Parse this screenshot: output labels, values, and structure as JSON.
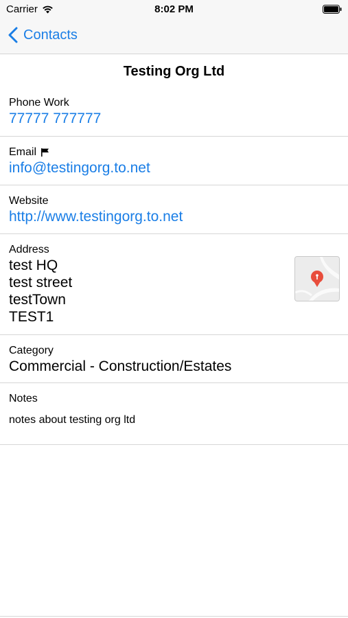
{
  "status_bar": {
    "carrier": "Carrier",
    "time": "8:02 PM",
    "icons": [
      "wifi-icon",
      "battery-icon"
    ]
  },
  "nav": {
    "back_label": "Contacts",
    "back_icon": "chevron-left-icon",
    "accent_color": "#1a7ee6"
  },
  "contact": {
    "title": "Testing Org Ltd",
    "phone": {
      "label": "Phone Work",
      "value": "77777 777777"
    },
    "email": {
      "label": "Email",
      "value": "info@testingorg.to.net",
      "icon": "flag-icon"
    },
    "website": {
      "label": "Website",
      "value": "http://www.testingorg.to.net"
    },
    "address": {
      "label": "Address",
      "lines": [
        "test HQ",
        "test street",
        "testTown",
        "TEST1"
      ],
      "map_icon": "map-pin-icon"
    },
    "category": {
      "label": "Category",
      "value": "Commercial - Construction/Estates"
    },
    "notes": {
      "label": "Notes",
      "value": "notes about testing org ltd"
    }
  }
}
